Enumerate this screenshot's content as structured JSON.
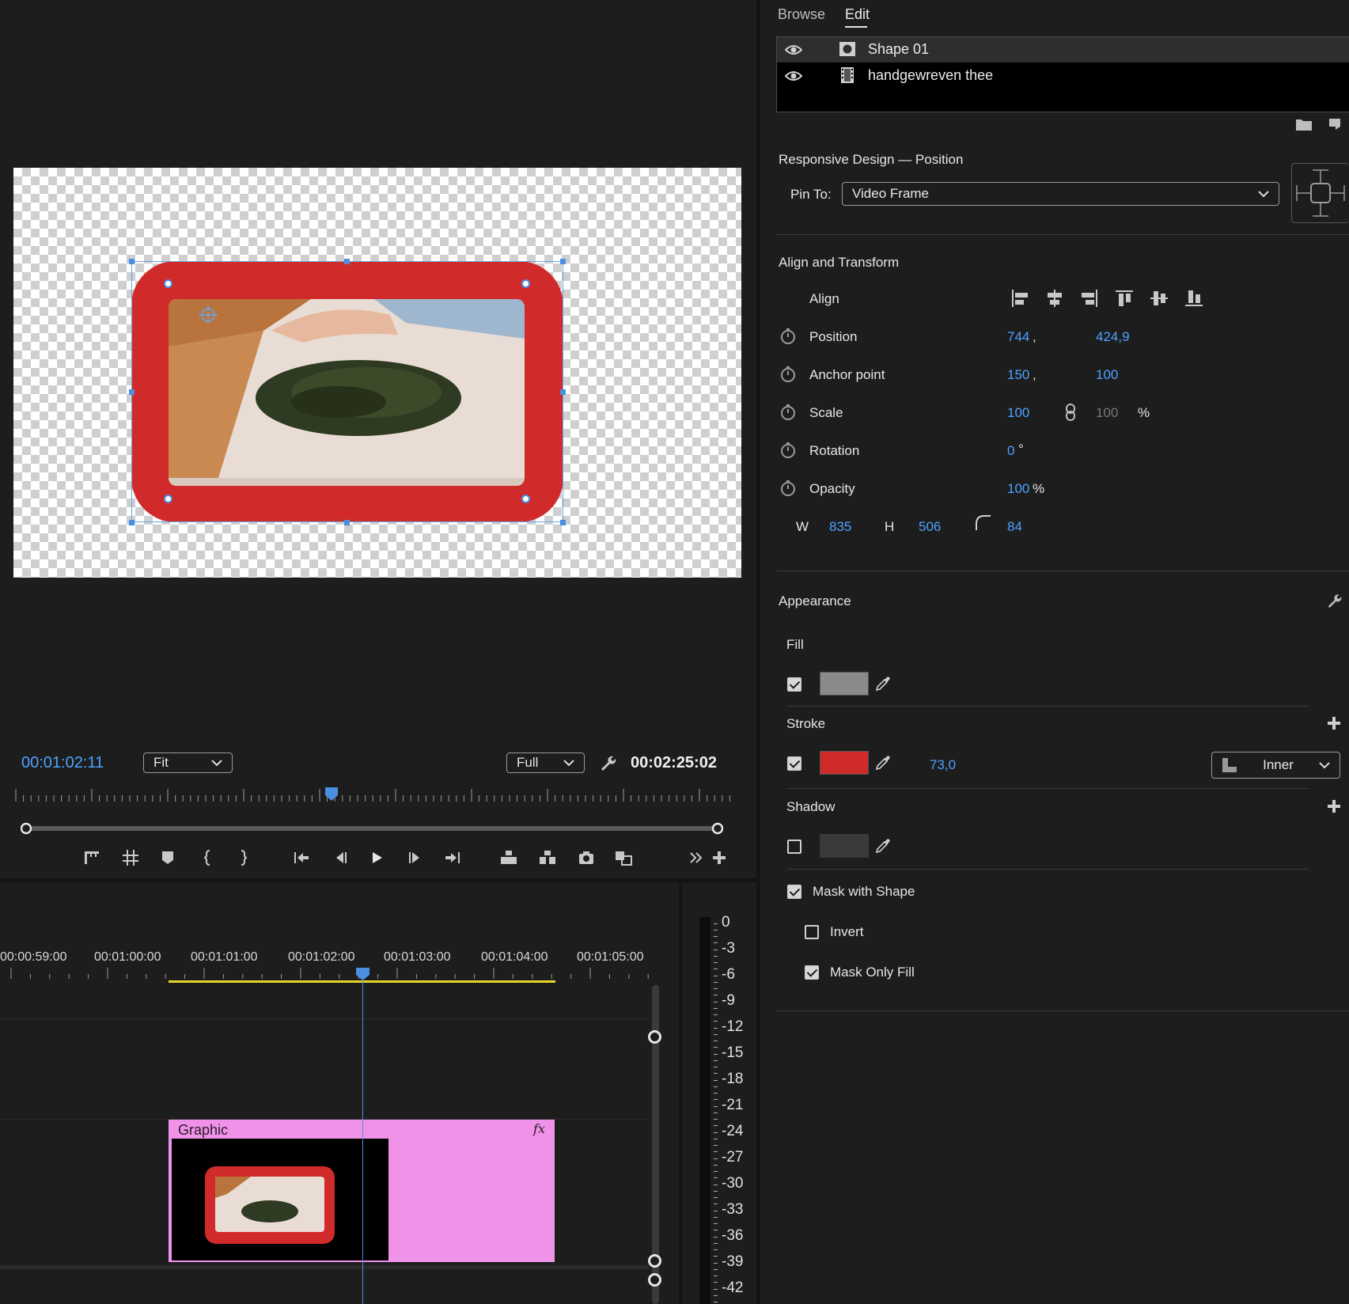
{
  "program_monitor": {
    "current_timecode": "00:01:02:11",
    "zoom_select": "Fit",
    "resolution_select": "Full",
    "duration_timecode": "00:02:25:02"
  },
  "timeline": {
    "timecodes": [
      "00:00:59:00",
      "00:01:00:00",
      "00:01:01:00",
      "00:01:02:00",
      "00:01:03:00",
      "00:01:04:00",
      "00:01:05:00"
    ],
    "clip": {
      "title": "Graphic",
      "fx_label": "fx"
    }
  },
  "audio_meter": {
    "db_labels": [
      "0",
      "-3",
      "-6",
      "-9",
      "-12",
      "-15",
      "-18",
      "-21",
      "-24",
      "-27",
      "-30",
      "-33",
      "-36",
      "-39",
      "-42"
    ]
  },
  "panel": {
    "tabs": [
      {
        "label": "Browse",
        "active": false
      },
      {
        "label": "Edit",
        "active": true
      }
    ],
    "layers": [
      {
        "name": "Shape 01",
        "icon": "shape-layer-icon"
      },
      {
        "name": "handgewreven thee",
        "icon": "video-layer-icon"
      }
    ],
    "responsive": {
      "title": "Responsive Design — Position",
      "pin_to_label": "Pin To:",
      "pin_to_value": "Video Frame"
    },
    "align_transform": {
      "title": "Align and Transform",
      "align_label": "Align",
      "position": {
        "label": "Position",
        "x": "744",
        "y": "424,9"
      },
      "anchor": {
        "label": "Anchor point",
        "x": "150",
        "y": "100"
      },
      "scale": {
        "label": "Scale",
        "value": "100",
        "value2": "100",
        "unit": "%"
      },
      "rotation": {
        "label": "Rotation",
        "value": "0",
        "unit": "°"
      },
      "opacity": {
        "label": "Opacity",
        "value": "100",
        "unit": "%"
      },
      "size": {
        "w_label": "W",
        "w": "835",
        "h_label": "H",
        "h": "506",
        "radius": "84"
      }
    },
    "appearance": {
      "title": "Appearance",
      "fill": {
        "label": "Fill",
        "checked": true,
        "color": "#8a8a8a"
      },
      "stroke": {
        "label": "Stroke",
        "checked": true,
        "color": "#d12a2a",
        "width": "73,0",
        "type": "Inner"
      },
      "shadow": {
        "label": "Shadow",
        "checked": false,
        "color": "#3a3a3a"
      },
      "mask_with_shape": "Mask with Shape",
      "invert": "Invert",
      "mask_only_fill": "Mask Only Fill"
    }
  },
  "colors": {
    "accent": "#4da3ff",
    "stroke_red": "#d12a2a",
    "clip_pink": "#f093e8",
    "inout_yellow": "#e8d42a"
  }
}
